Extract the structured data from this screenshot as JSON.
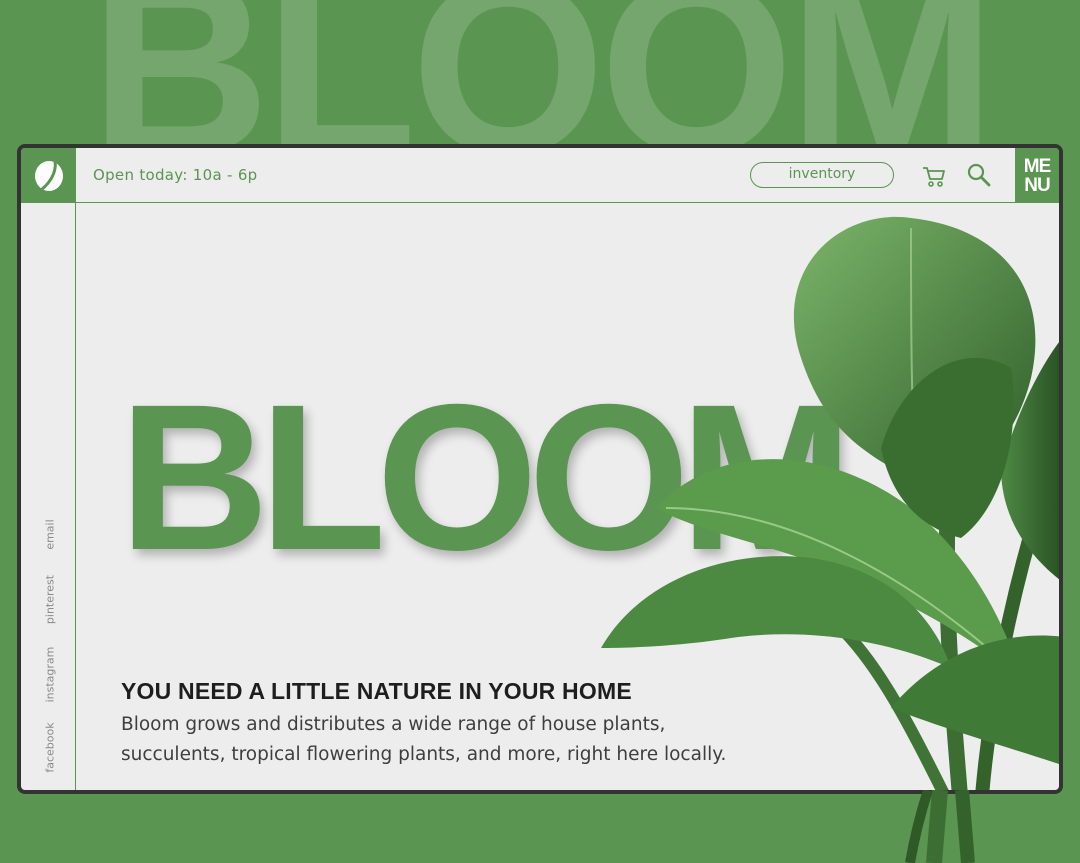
{
  "brand": {
    "name": "BLOOM",
    "background_word": "BLOOM"
  },
  "header": {
    "hours": "Open today: 10a - 6p",
    "inventory_label": "inventory",
    "menu_top": "ME",
    "menu_bottom": "NU"
  },
  "social": [
    "email",
    "pinterest",
    "instagram",
    "facebook"
  ],
  "hero": {
    "headline": "YOU NEED A LITTLE NATURE IN YOUR HOME",
    "description": "Bloom grows and distributes a wide range of house plants, succulents, tropical flowering plants, and more, right here locally."
  },
  "icons": {
    "logo": "leaf-icon",
    "cart": "cart-icon",
    "search": "search-icon"
  },
  "colors": {
    "brand_green": "#5a9551",
    "window_bg": "#ededed",
    "frame": "#333333",
    "headline": "#1e1e1e"
  }
}
